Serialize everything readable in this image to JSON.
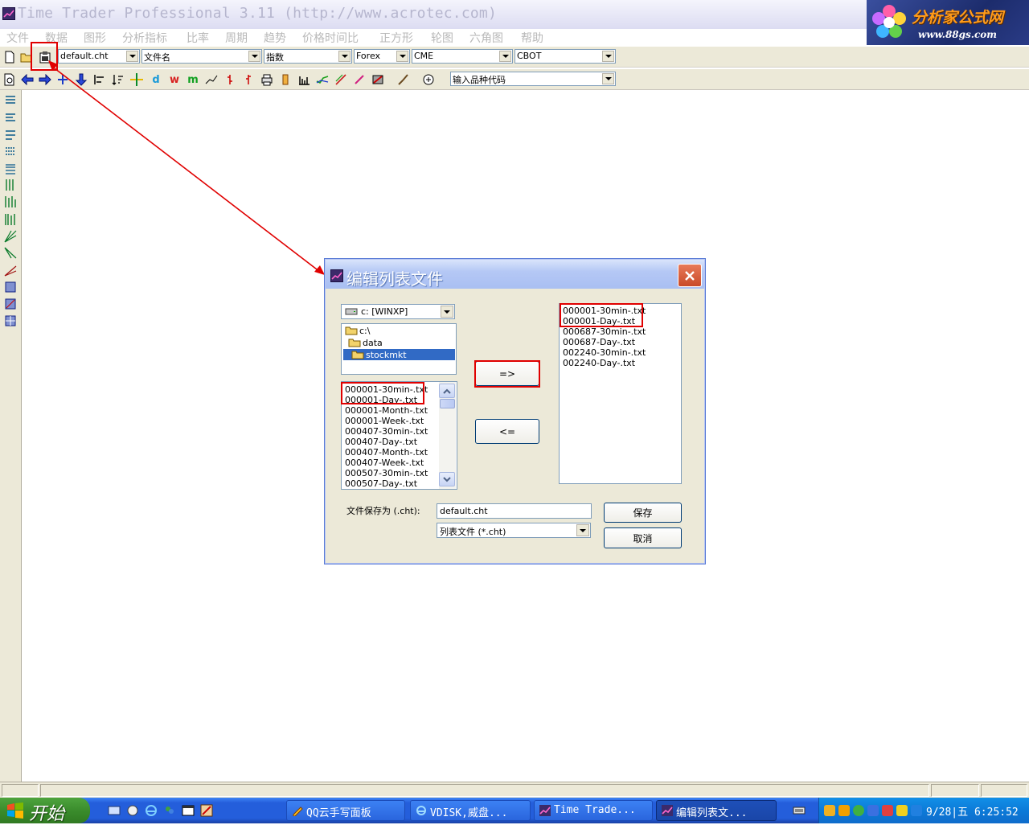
{
  "window": {
    "title": "Time Trader Professional 3.11 (http://www.acrotec.com)"
  },
  "watermark": {
    "title": "分析家公式网",
    "url": "www.88gs.com"
  },
  "menu": [
    "文件",
    "数据",
    "图形",
    "分析指标",
    "比率",
    "周期",
    "趋势",
    "价格时间比",
    "正方形",
    "轮图",
    "六角图",
    "帮助"
  ],
  "toolbar1": {
    "combos": [
      {
        "name": "chart-file-combo",
        "value": "default.cht"
      },
      {
        "name": "filename-combo",
        "value": "文件名"
      },
      {
        "name": "index-combo",
        "value": "指数"
      },
      {
        "name": "forex-combo",
        "value": "Forex"
      },
      {
        "name": "cme-combo",
        "value": "CME"
      },
      {
        "name": "cbot-combo",
        "value": "CBOT"
      }
    ]
  },
  "toolbar2": {
    "symbol_combo": "输入品种代码",
    "letter_buttons": [
      "d",
      "w",
      "m"
    ]
  },
  "dialog": {
    "title": "编辑列表文件",
    "drive": "c: [WINXP]",
    "folders": [
      "c:\\",
      "data",
      "stockmkt"
    ],
    "selected_folder": "stockmkt",
    "source_files": [
      "000001-30min-.txt",
      "000001-Day-.txt",
      "000001-Month-.txt",
      "000001-Week-.txt",
      "000407-30min-.txt",
      "000407-Day-.txt",
      "000407-Month-.txt",
      "000407-Week-.txt",
      "000507-30min-.txt",
      "000507-Day-.txt"
    ],
    "add_label": "=>",
    "remove_label": "<=",
    "target_files": [
      "000001-30min-.txt",
      "000001-Day-.txt",
      "000687-30min-.txt",
      "000687-Day-.txt",
      "002240-30min-.txt",
      "002240-Day-.txt"
    ],
    "save_as_label": "文件保存为 (.cht):",
    "save_as_value": "default.cht",
    "file_type": "列表文件 (*.cht)",
    "save_label": "保存",
    "cancel_label": "取消"
  },
  "taskbar": {
    "start_label": "开始",
    "tasks": [
      "QQ云手写面板",
      "VDISK,威盘...",
      "Time Trade...",
      "编辑列表文..."
    ],
    "clock": "9/28|五 6:25:52"
  },
  "annotation_color": "#e00000"
}
